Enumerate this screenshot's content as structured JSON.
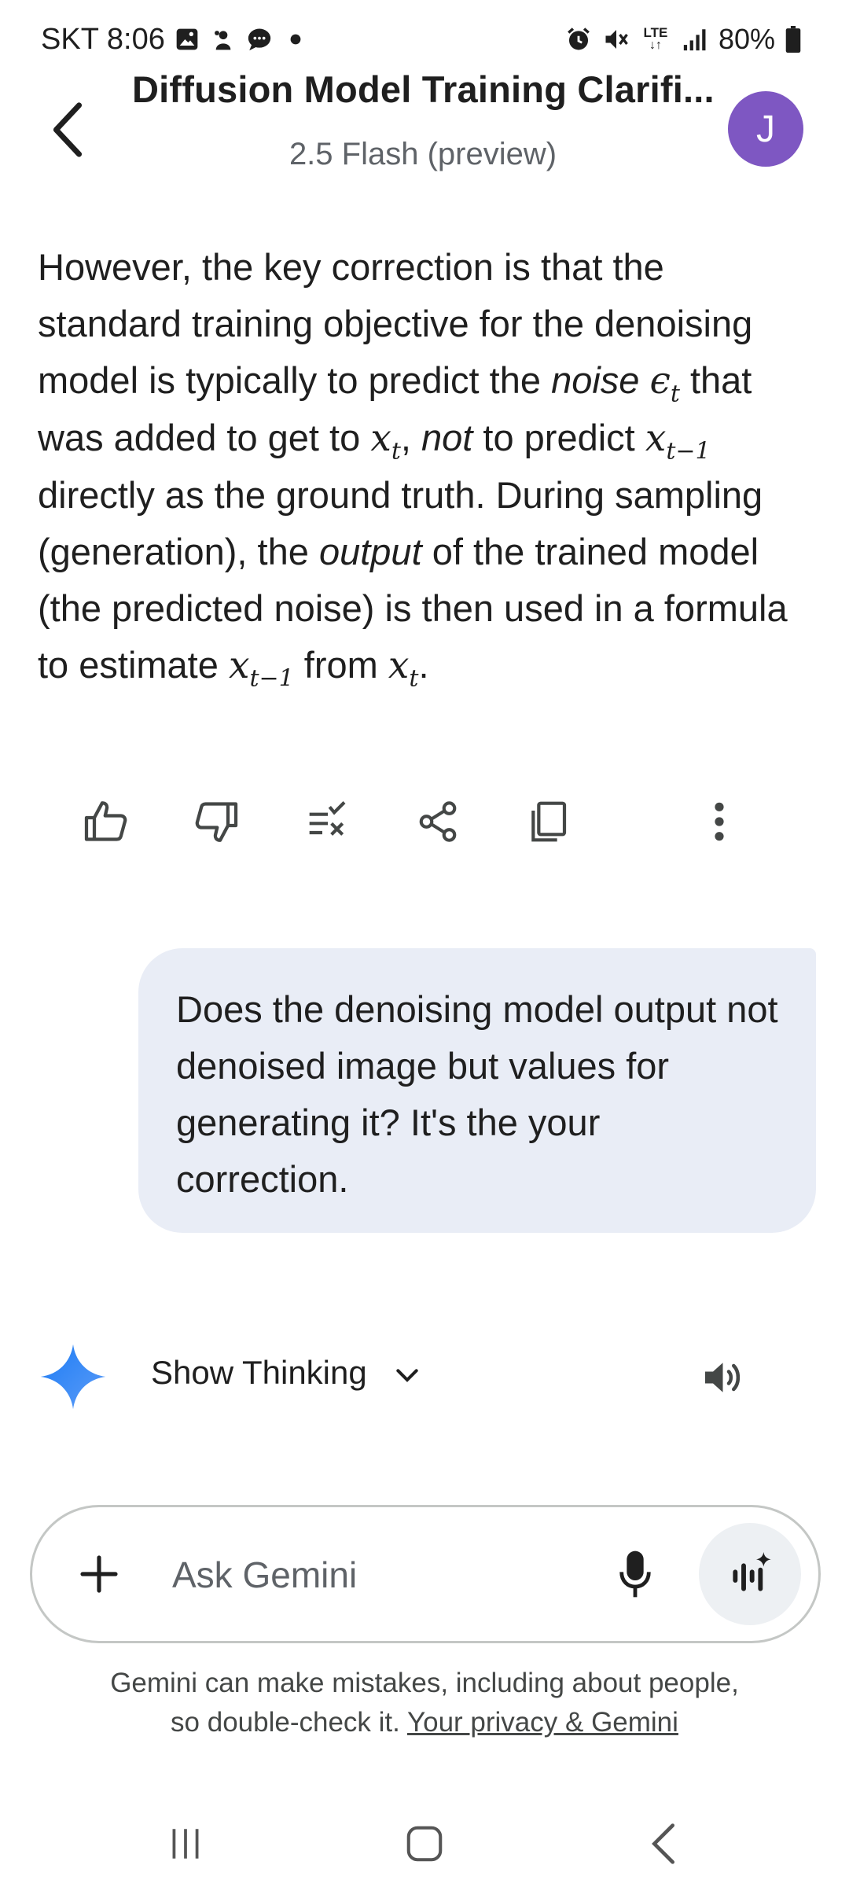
{
  "status_bar": {
    "carrier": "SKT",
    "time": "8:06",
    "network": "LTE",
    "battery": "80%"
  },
  "header": {
    "title": "Diffusion Model Training Clarifi...",
    "model": "2.5 Flash (preview)",
    "avatar_initial": "J"
  },
  "response": {
    "p1": "However, the key correction is that the standard training objective for the denoising model is typically to predict the ",
    "noise_word": "noise",
    "epsilon": "ϵ",
    "epsilon_sub": "t",
    "p2": " that was added to get to ",
    "x1": "x",
    "x1_sub": "t",
    "comma": ",",
    "not_word": "not",
    "p3": " to predict ",
    "x2": "x",
    "x2_sub": "t−1",
    "p4": " directly as the ground truth. During sampling (generation), the ",
    "output_word": "output",
    "p5": " of the trained model (the predicted noise) is then used in a formula to estimate ",
    "x3": "x",
    "x3_sub": "t−1",
    "p6": " from ",
    "x4": "x",
    "x4_sub": "t",
    "period": "."
  },
  "actions": {
    "icons": [
      "thumbs-up-icon",
      "thumbs-down-icon",
      "modify-response-icon",
      "share-icon",
      "copy-icon",
      "more-vert-icon"
    ]
  },
  "user_message": {
    "text": "Does the denoising model output not denoised image but values for generating it? It's the your correction."
  },
  "thinking": {
    "label": "Show Thinking"
  },
  "input": {
    "placeholder": "Ask Gemini"
  },
  "disclaimer": {
    "line1": "Gemini can make mistakes, including about people,",
    "line2_prefix": "so double-check it. ",
    "link": "Your privacy & Gemini"
  },
  "colors": {
    "accent_avatar": "#7e57c2",
    "user_bubble": "#e9edf6",
    "spark_blue": "#4285f4"
  }
}
